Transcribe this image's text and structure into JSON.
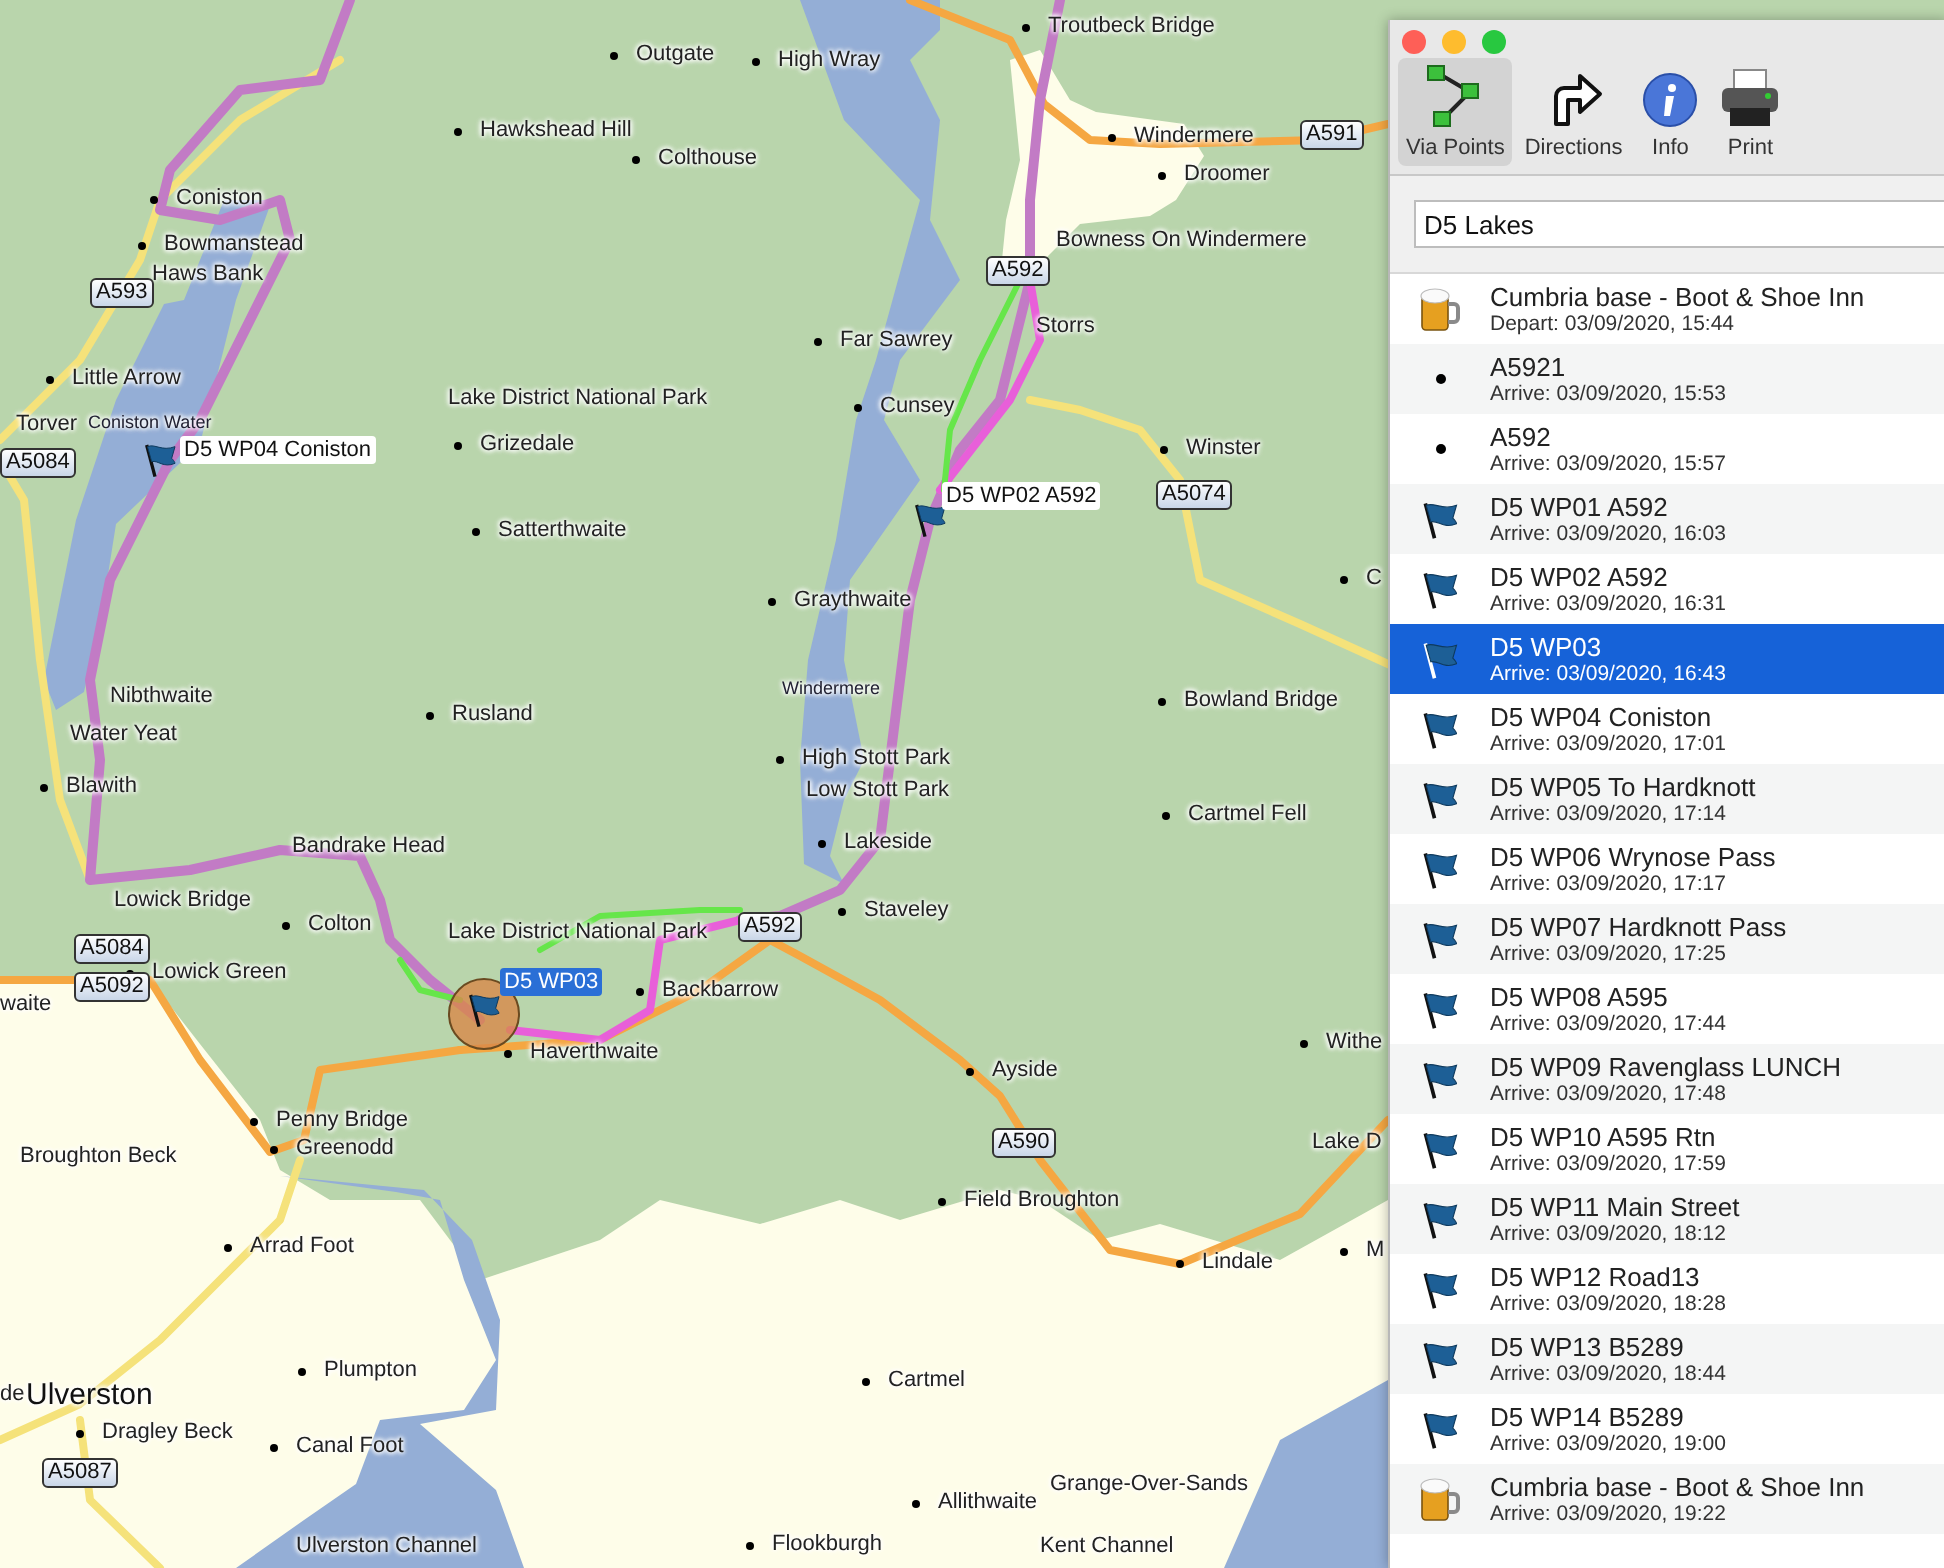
{
  "map": {
    "places": [
      {
        "name": "Outgate",
        "kind": "place"
      },
      {
        "name": "High Wray",
        "kind": "place"
      },
      {
        "name": "Hawkshead Hill",
        "kind": "place"
      },
      {
        "name": "Colthouse",
        "kind": "place"
      },
      {
        "name": "Troutbeck Bridge",
        "kind": "place"
      },
      {
        "name": "Windermere",
        "kind": "place"
      },
      {
        "name": "Droomer",
        "kind": "place"
      },
      {
        "name": "Bowness On Windermere",
        "kind": "name"
      },
      {
        "name": "Coniston",
        "kind": "place"
      },
      {
        "name": "Bowmanstead",
        "kind": "place"
      },
      {
        "name": "Haws Bank",
        "kind": "name"
      },
      {
        "name": "Little Arrow",
        "kind": "place"
      },
      {
        "name": "Torver",
        "kind": "name"
      },
      {
        "name": "Coniston Water",
        "kind": "water"
      },
      {
        "name": "Lake District National Park",
        "kind": "name"
      },
      {
        "name": "Grizedale",
        "kind": "place"
      },
      {
        "name": "Satterthwaite",
        "kind": "place"
      },
      {
        "name": "Far Sawrey",
        "kind": "place"
      },
      {
        "name": "Storrs",
        "kind": "name"
      },
      {
        "name": "Cunsey",
        "kind": "place"
      },
      {
        "name": "Winster",
        "kind": "place"
      },
      {
        "name": "C",
        "kind": "place"
      },
      {
        "name": "Graythwaite",
        "kind": "place"
      },
      {
        "name": "Windermere",
        "kind": "water"
      },
      {
        "name": "Nibthwaite",
        "kind": "name"
      },
      {
        "name": "Water Yeat",
        "kind": "name"
      },
      {
        "name": "Blawith",
        "kind": "place"
      },
      {
        "name": "Rusland",
        "kind": "place"
      },
      {
        "name": "Bowland Bridge",
        "kind": "place"
      },
      {
        "name": "High Stott Park",
        "kind": "place"
      },
      {
        "name": "Low Stott Park",
        "kind": "name"
      },
      {
        "name": "Cartmel Fell",
        "kind": "place"
      },
      {
        "name": "Lakeside",
        "kind": "place"
      },
      {
        "name": "Staveley",
        "kind": "place"
      },
      {
        "name": "Bandrake Head",
        "kind": "name"
      },
      {
        "name": "Lowick Bridge",
        "kind": "name"
      },
      {
        "name": "Colton",
        "kind": "place"
      },
      {
        "name": "Lake District National Park",
        "kind": "name"
      },
      {
        "name": "Lowick Green",
        "kind": "place"
      },
      {
        "name": "waite",
        "kind": "name"
      },
      {
        "name": "Backbarrow",
        "kind": "place"
      },
      {
        "name": "Haverthwaite",
        "kind": "place"
      },
      {
        "name": "Penny Bridge",
        "kind": "place"
      },
      {
        "name": "Greenodd",
        "kind": "place"
      },
      {
        "name": "Broughton Beck",
        "kind": "name"
      },
      {
        "name": "Ayside",
        "kind": "place"
      },
      {
        "name": "Withe",
        "kind": "place"
      },
      {
        "name": "Lake D",
        "kind": "name"
      },
      {
        "name": "Field Broughton",
        "kind": "place"
      },
      {
        "name": "Lindale",
        "kind": "place"
      },
      {
        "name": "M",
        "kind": "place"
      },
      {
        "name": "Arrad Foot",
        "kind": "place"
      },
      {
        "name": "Plumpton",
        "kind": "place"
      },
      {
        "name": "de",
        "kind": "name"
      },
      {
        "name": "Ulverston",
        "kind": "city"
      },
      {
        "name": "Dragley Beck",
        "kind": "place"
      },
      {
        "name": "Canal Foot",
        "kind": "place"
      },
      {
        "name": "Cartmel",
        "kind": "place"
      },
      {
        "name": "Grange-Over-Sands",
        "kind": "name"
      },
      {
        "name": "Allithwaite",
        "kind": "place"
      },
      {
        "name": "Ulverston Channel",
        "kind": "name"
      },
      {
        "name": "Flookburgh",
        "kind": "place"
      },
      {
        "name": "Kent Channel",
        "kind": "name"
      }
    ],
    "road_shields": [
      "A591",
      "A592",
      "A5074",
      "A593",
      "A5084",
      "A5084",
      "A5092",
      "A592",
      "A590",
      "A5087"
    ],
    "waypoints": [
      {
        "label": "D5 WP04 Coniston",
        "selected": false
      },
      {
        "label": "D5 WP02 A592",
        "selected": false
      },
      {
        "label": "D5 WP03",
        "selected": true
      }
    ]
  },
  "panel": {
    "toolbar": [
      {
        "label": "Via Points",
        "kind": "via",
        "selected": true
      },
      {
        "label": "Directions",
        "kind": "directions",
        "selected": false
      },
      {
        "label": "Info",
        "kind": "info",
        "selected": false
      },
      {
        "label": "Print",
        "kind": "print",
        "selected": false
      }
    ],
    "route_name": "D5 Lakes",
    "via_points": [
      {
        "name": "Cumbria base - Boot & Shoe Inn",
        "time": "Depart: 03/09/2020, 15:44",
        "kind": "inn",
        "selected": false
      },
      {
        "name": "A5921",
        "time": "Arrive: 03/09/2020, 15:53",
        "kind": "dot",
        "selected": false
      },
      {
        "name": "A592",
        "time": "Arrive: 03/09/2020, 15:57",
        "kind": "dot",
        "selected": false
      },
      {
        "name": "D5 WP01 A592",
        "time": "Arrive: 03/09/2020, 16:03",
        "kind": "flag",
        "selected": false
      },
      {
        "name": "D5 WP02 A592",
        "time": "Arrive: 03/09/2020, 16:31",
        "kind": "flag",
        "selected": false
      },
      {
        "name": "D5 WP03",
        "time": "Arrive: 03/09/2020, 16:43",
        "kind": "flag",
        "selected": true
      },
      {
        "name": "D5 WP04 Coniston",
        "time": "Arrive: 03/09/2020, 17:01",
        "kind": "flag",
        "selected": false
      },
      {
        "name": "D5 WP05 To Hardknott",
        "time": "Arrive: 03/09/2020, 17:14",
        "kind": "flag",
        "selected": false
      },
      {
        "name": "D5 WP06 Wrynose Pass",
        "time": "Arrive: 03/09/2020, 17:17",
        "kind": "flag",
        "selected": false
      },
      {
        "name": "D5 WP07 Hardknott Pass",
        "time": "Arrive: 03/09/2020, 17:25",
        "kind": "flag",
        "selected": false
      },
      {
        "name": "D5 WP08 A595",
        "time": "Arrive: 03/09/2020, 17:44",
        "kind": "flag",
        "selected": false
      },
      {
        "name": "D5 WP09 Ravenglass LUNCH",
        "time": "Arrive: 03/09/2020, 17:48",
        "kind": "flag",
        "selected": false
      },
      {
        "name": "D5 WP10 A595 Rtn",
        "time": "Arrive: 03/09/2020, 17:59",
        "kind": "flag",
        "selected": false
      },
      {
        "name": "D5 WP11 Main Street",
        "time": "Arrive: 03/09/2020, 18:12",
        "kind": "flag",
        "selected": false
      },
      {
        "name": "D5 WP12 Road13",
        "time": "Arrive: 03/09/2020, 18:28",
        "kind": "flag",
        "selected": false
      },
      {
        "name": "D5 WP13 B5289",
        "time": "Arrive: 03/09/2020, 18:44",
        "kind": "flag",
        "selected": false
      },
      {
        "name": "D5 WP14 B5289",
        "time": "Arrive: 03/09/2020, 19:00",
        "kind": "flag",
        "selected": false
      },
      {
        "name": "Cumbria base - Boot & Shoe Inn",
        "time": "Arrive: 03/09/2020, 19:22",
        "kind": "inn",
        "selected": false
      }
    ]
  }
}
